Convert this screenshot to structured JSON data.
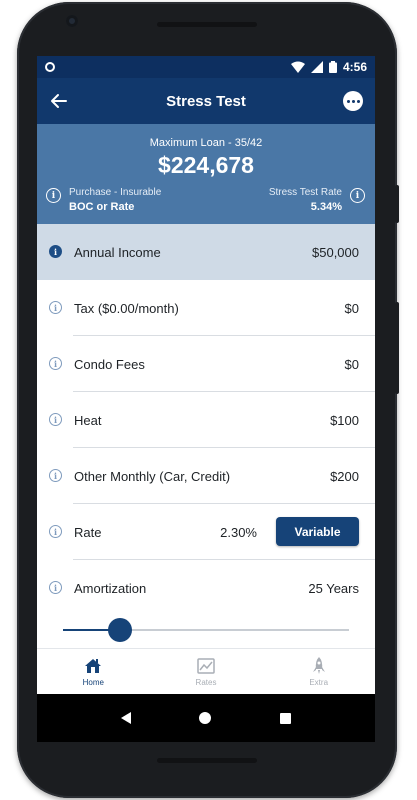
{
  "status_bar": {
    "time": "4:56"
  },
  "app_bar": {
    "title": "Stress Test"
  },
  "summary": {
    "subtitle": "Maximum Loan - 35/42",
    "amount": "$224,678",
    "left_label": "Purchase - Insurable",
    "left_value": "BOC or Rate",
    "right_label": "Stress Test Rate",
    "right_value": "5.34%"
  },
  "rows": [
    {
      "label": "Annual Income",
      "value": "$50,000"
    },
    {
      "label": "Tax ($0.00/month)",
      "value": "$0"
    },
    {
      "label": "Condo Fees",
      "value": "$0"
    },
    {
      "label": "Heat",
      "value": "$100"
    },
    {
      "label": "Other Monthly (Car, Credit)",
      "value": "$200"
    },
    {
      "label": "Rate",
      "value": "2.30%",
      "button": "Variable"
    },
    {
      "label": "Amortization",
      "value": "25 Years"
    }
  ],
  "amortization_slider": {
    "fraction": 0.2
  },
  "bottom_nav": [
    {
      "label": "Home"
    },
    {
      "label": "Rates"
    },
    {
      "label": "Extra"
    }
  ],
  "colors": {
    "app_bar": "#11386c",
    "summary_bg": "#4a77a6",
    "active_row": "#cfdae6",
    "accent": "#164378"
  },
  "icons": [
    "back-arrow-icon",
    "more-icon",
    "info-icon",
    "home-icon",
    "chart-icon",
    "rocket-icon"
  ]
}
